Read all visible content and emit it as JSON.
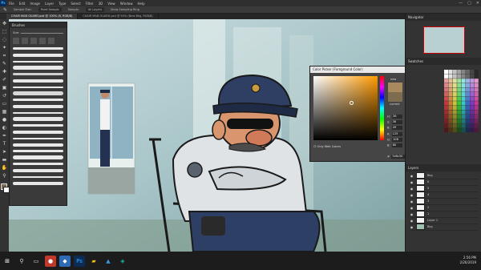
{
  "menubar": {
    "items": [
      "File",
      "Edit",
      "Image",
      "Layer",
      "Type",
      "Select",
      "Filter",
      "3D",
      "View",
      "Window",
      "Help"
    ],
    "ps_label": "Ps",
    "minimize": "—",
    "maximize": "▢",
    "close": "✕"
  },
  "options": {
    "sample": "Sample Size:",
    "size_value": "Point Sample",
    "sample_label": "Sample:",
    "sample_value": "All Layers",
    "show_ring": "Show Sampling Ring"
  },
  "tabs": [
    {
      "label": "CHAIR MAN GUARD.psd @ 100% (6, RGB/8)",
      "active": true
    },
    {
      "label": "CHAIR MAN GUARD.psd @ 50% (New Bkg, RGB/8)",
      "active": false
    }
  ],
  "brushes": {
    "title": "Brushes",
    "search": "Size:"
  },
  "picker": {
    "title": "Color Picker (Foreground Color)",
    "new_label": "new",
    "current_label": "current",
    "ok": "OK",
    "cancel": "Cancel",
    "add_swatches": "Add to Swatches",
    "libraries": "Color Libraries",
    "web_only": "Only Web Colors",
    "fields": [
      {
        "label": "H:",
        "value": "36",
        "unit": "°"
      },
      {
        "label": "S:",
        "value": "36",
        "unit": "%"
      },
      {
        "label": "B:",
        "value": "49",
        "unit": "%"
      },
      {
        "label": "R:",
        "value": "125",
        "unit": ""
      },
      {
        "label": "G:",
        "value": "108",
        "unit": ""
      },
      {
        "label": "B:",
        "value": "80",
        "unit": ""
      }
    ],
    "lab": [
      {
        "label": "L:",
        "value": "47"
      },
      {
        "label": "a:",
        "value": "2"
      },
      {
        "label": "b:",
        "value": "16"
      }
    ],
    "cmyk": [
      {
        "label": "C:",
        "value": "48",
        "unit": "%"
      },
      {
        "label": "M:",
        "value": "51",
        "unit": "%"
      },
      {
        "label": "Y:",
        "value": "73",
        "unit": "%"
      },
      {
        "label": "K:",
        "value": "24",
        "unit": "%"
      }
    ],
    "hex": "7d6c50",
    "swatch_color": "#a88a5e",
    "current_color": "#7d6c50"
  },
  "dock": {
    "navigator": "Navigator",
    "swatches": "Swatches",
    "layers_title": "Layers",
    "layers": [
      "Bkg",
      "6",
      "5",
      "4",
      "3",
      "2",
      "1",
      "Layer 1",
      "Bkg"
    ]
  },
  "taskbar": {
    "time": "2:56 PM",
    "date": "2/26/2019"
  },
  "colors": {
    "accent": "#31a8ff"
  }
}
